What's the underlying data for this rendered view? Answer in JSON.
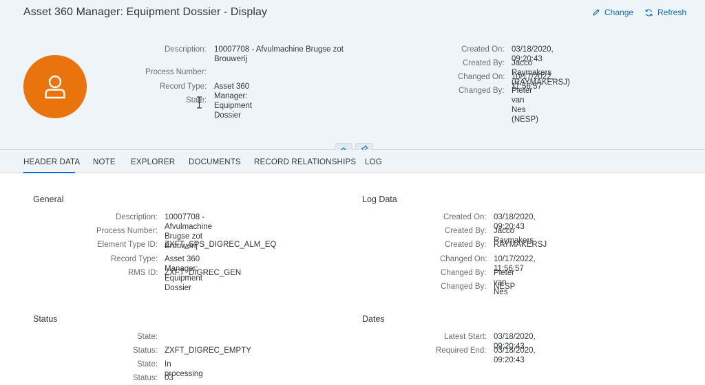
{
  "app": {
    "title": "Asset 360 Manager: Equipment Dossier - Display",
    "actions": {
      "change": "Change",
      "refresh": "Refresh"
    },
    "accent": "#0a6ed1",
    "avatar_color": "#e9730c"
  },
  "header": {
    "left": [
      {
        "label": "Description:",
        "value": "10007708 - Afvulmachine Brugse zot Brouwerij"
      },
      {
        "label": "Process Number:",
        "value": ""
      },
      {
        "label": "Record Type:",
        "value": "Asset 360 Manager: Equipment Dossier"
      },
      {
        "label": "State:",
        "value": ""
      }
    ],
    "right": [
      {
        "label": "Created On:",
        "value": "03/18/2020, 09:20:43"
      },
      {
        "label": "Created By:",
        "value": "Jacco Raymakers (RAYMAKERSJ)"
      },
      {
        "label": "Changed On:",
        "value": "10/17/2022, 11:56:57"
      },
      {
        "label": "Changed By:",
        "value": "Pieter van Nes (NESP)"
      }
    ]
  },
  "tabs": [
    {
      "label": "HEADER DATA",
      "active": true
    },
    {
      "label": "NOTE"
    },
    {
      "label": "EXPLORER"
    },
    {
      "label": "DOCUMENTS"
    },
    {
      "label": "RECORD RELATIONSHIPS"
    },
    {
      "label": "LOG"
    }
  ],
  "sections": {
    "general": {
      "title": "General",
      "rows": [
        {
          "label": "Description:",
          "value": "10007708 - Afvulmachine Brugse zot Brouwerij"
        },
        {
          "label": "Process Number:",
          "value": ""
        },
        {
          "label": "Element Type ID:",
          "value": "ZXFT_SPS_DIGREC_ALM_EQ"
        },
        {
          "label": "Record Type:",
          "value": "Asset 360 Manager: Equipment Dossier"
        },
        {
          "label": "RMS ID:",
          "value": "ZXFT_DIGREC_GEN"
        }
      ]
    },
    "log": {
      "title": "Log Data",
      "rows": [
        {
          "label": "Created On:",
          "value": "03/18/2020, 09:20:43"
        },
        {
          "label": "Created By:",
          "value": "Jacco Raymakers"
        },
        {
          "label": "Created By:",
          "value": "RAYMAKERSJ"
        },
        {
          "label": "Changed On:",
          "value": "10/17/2022, 11:56:57"
        },
        {
          "label": "Changed By:",
          "value": "Pieter van Nes"
        },
        {
          "label": "Changed By:",
          "value": "NESP"
        }
      ]
    },
    "status": {
      "title": "Status",
      "rows": [
        {
          "label": "State:",
          "value": ""
        },
        {
          "label": "Status:",
          "value": "ZXFT_DIGREC_EMPTY"
        },
        {
          "label": "State:",
          "value": "In processing"
        },
        {
          "label": "Status:",
          "value": "03"
        }
      ]
    },
    "dates": {
      "title": "Dates",
      "rows": [
        {
          "label": "Latest Start:",
          "value": "03/18/2020, 09:20:43"
        },
        {
          "label": "Required End:",
          "value": "03/18/2020, 09:20:43"
        }
      ]
    }
  }
}
